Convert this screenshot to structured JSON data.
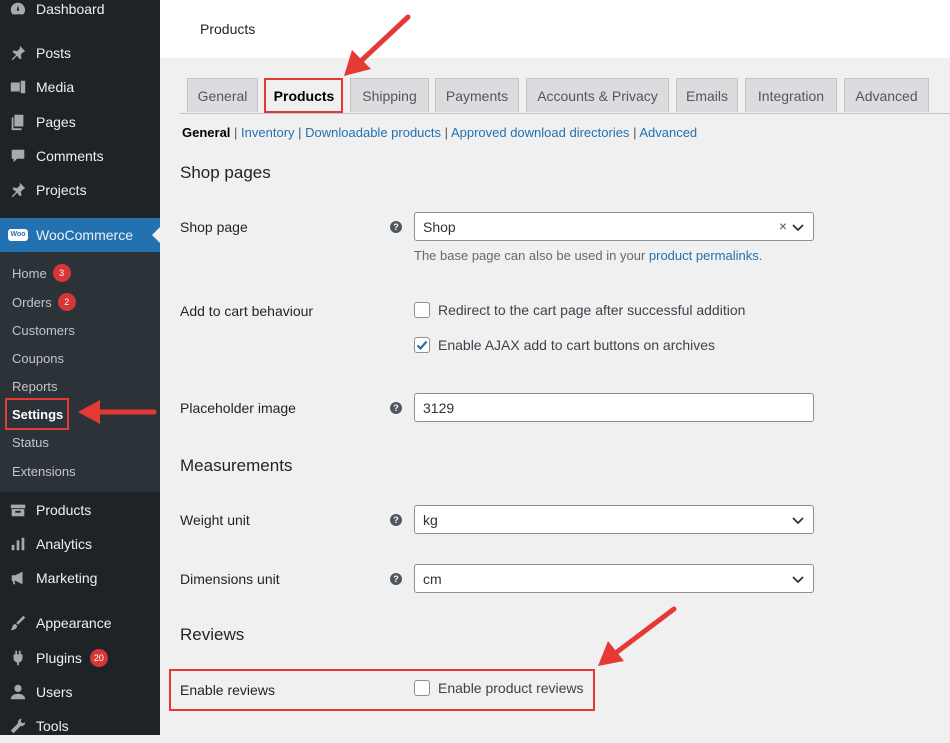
{
  "sidebar": {
    "top_items": [
      {
        "label": "Dashboard",
        "icon": "dashboard-icon"
      },
      {
        "label": "Posts",
        "icon": "pin-icon"
      },
      {
        "label": "Media",
        "icon": "media-icon"
      },
      {
        "label": "Pages",
        "icon": "pages-icon"
      },
      {
        "label": "Comments",
        "icon": "comments-icon"
      },
      {
        "label": "Projects",
        "icon": "pin-icon"
      }
    ],
    "woocommerce": {
      "label": "WooCommerce",
      "icon": "woo-icon",
      "icon_text": "Woo"
    },
    "submenu": [
      {
        "label": "Home",
        "badge": "3"
      },
      {
        "label": "Orders",
        "badge": "2"
      },
      {
        "label": "Customers"
      },
      {
        "label": "Coupons"
      },
      {
        "label": "Reports"
      },
      {
        "label": "Settings",
        "current": true
      },
      {
        "label": "Status"
      },
      {
        "label": "Extensions"
      }
    ],
    "bottom_items": [
      {
        "label": "Products",
        "icon": "products-icon"
      },
      {
        "label": "Analytics",
        "icon": "analytics-icon"
      },
      {
        "label": "Marketing",
        "icon": "megaphone-icon"
      },
      {
        "label": "Appearance",
        "icon": "brush-icon"
      },
      {
        "label": "Plugins",
        "icon": "plug-icon",
        "badge": "20"
      },
      {
        "label": "Users",
        "icon": "users-icon"
      },
      {
        "label": "Tools",
        "icon": "wrench-icon"
      }
    ]
  },
  "header": {
    "title": "Products"
  },
  "tabs": [
    "General",
    "Products",
    "Shipping",
    "Payments",
    "Accounts & Privacy",
    "Emails",
    "Integration",
    "Advanced"
  ],
  "active_tab": "Products",
  "subnav": [
    {
      "label": "General",
      "current": true
    },
    {
      "label": "Inventory"
    },
    {
      "label": "Downloadable products"
    },
    {
      "label": "Approved download directories"
    },
    {
      "label": "Advanced"
    }
  ],
  "sections": {
    "shop_pages": {
      "heading": "Shop pages",
      "shop_page": {
        "label": "Shop page",
        "value": "Shop",
        "desc_prefix": "The base page can also be used in your ",
        "desc_link": "product permalinks",
        "desc_suffix": "."
      },
      "add_to_cart": {
        "label": "Add to cart behaviour",
        "option1": {
          "label": "Redirect to the cart page after successful addition",
          "checked": false
        },
        "option2": {
          "label": "Enable AJAX add to cart buttons on archives",
          "checked": true
        }
      },
      "placeholder": {
        "label": "Placeholder image",
        "value": "3129"
      }
    },
    "measurements": {
      "heading": "Measurements",
      "weight": {
        "label": "Weight unit",
        "value": "kg"
      },
      "dimensions": {
        "label": "Dimensions unit",
        "value": "cm"
      }
    },
    "reviews": {
      "heading": "Reviews",
      "enable": {
        "label": "Enable reviews",
        "option": "Enable product reviews",
        "checked": false
      }
    }
  },
  "help_glyph": "?",
  "clear_glyph": "×",
  "colors": {
    "accent": "#2271b1",
    "annotation": "#e53935",
    "sidebar": "#1d2327",
    "badge": "#d63638"
  }
}
